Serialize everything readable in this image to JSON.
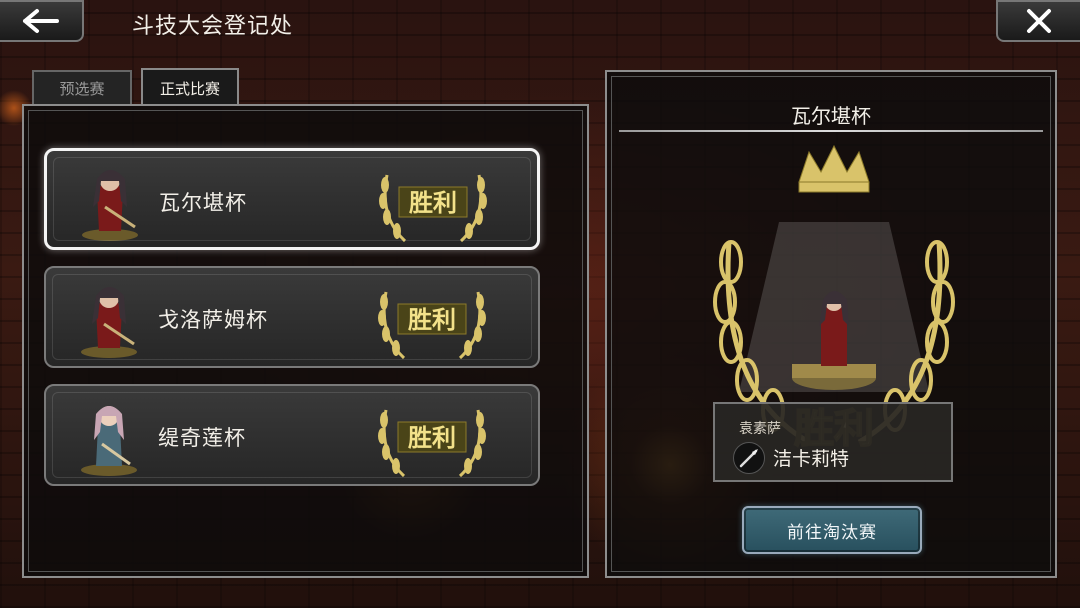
{
  "header": {
    "title": "斗技大会登记处",
    "back_icon": "arrow-left-icon",
    "close_icon": "close-icon"
  },
  "tabs": [
    {
      "label": "预选赛",
      "active": false
    },
    {
      "label": "正式比赛",
      "active": true
    }
  ],
  "cups": [
    {
      "name": "瓦尔堪杯",
      "result": "胜利",
      "selected": true,
      "portrait": "dark-haired-warrior"
    },
    {
      "name": "戈洛萨姆杯",
      "result": "胜利",
      "selected": false,
      "portrait": "dark-haired-warrior"
    },
    {
      "name": "缇奇莲杯",
      "result": "胜利",
      "selected": false,
      "portrait": "light-haired-hunter"
    }
  ],
  "detail": {
    "title": "瓦尔堪杯",
    "result": "胜利",
    "opponent_label": "袁素萨",
    "weapon_icon": "spear-icon",
    "opponent_name": "洁卡莉特",
    "button_label": "前往淘汰赛"
  },
  "colors": {
    "gold": "#d9c36a",
    "badge_bg": "#4a4418",
    "button_teal": "#3f6a78"
  }
}
